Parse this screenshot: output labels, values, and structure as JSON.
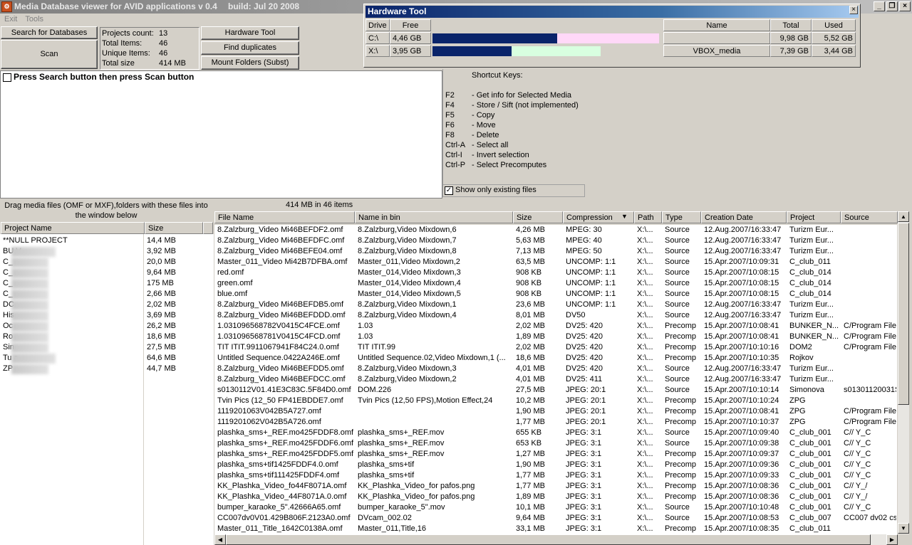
{
  "window": {
    "title": "Media Database viewer for AVID applications v 0.4",
    "build": "build: Jul 20 2008"
  },
  "menu": [
    "Exit",
    "Tools"
  ],
  "buttons": {
    "search": "Search for Databases",
    "scan": "Scan",
    "hardware": "Hardware Tool",
    "duplicates": "Find duplicates",
    "mount": "Mount Folders (Subst)"
  },
  "info": [
    {
      "label": "Projects count:",
      "value": "13"
    },
    {
      "label": "Total Items:",
      "value": "46"
    },
    {
      "label": "Unique Items:",
      "value": "46"
    },
    {
      "label": "Total size",
      "value": "414 MB"
    }
  ],
  "message": "Press Search button then press Scan button",
  "shortcuts": {
    "title": "Shortcut Keys:",
    "items": [
      {
        "key": "F2",
        "desc": "- Get info for Selected Media"
      },
      {
        "key": "F4",
        "desc": "- Store / Sift (not implemented)"
      },
      {
        "key": "F5",
        "desc": "- Copy"
      },
      {
        "key": "F6",
        "desc": "- Move"
      },
      {
        "key": "F8",
        "desc": "- Delete"
      },
      {
        "key": "Ctrl-A",
        "desc": "- Select all"
      },
      {
        "key": "Ctrl-I",
        "desc": "- Invert selection"
      },
      {
        "key": "Ctrl-P",
        "desc": "- Select Precomputes"
      }
    ],
    "existing_label": "Show only existing files"
  },
  "hwtool": {
    "title": "Hardware Tool",
    "drive_headers": [
      "Drive",
      "Free"
    ],
    "drives": [
      {
        "drive": "C:\\",
        "free": "4,46 GB",
        "used_fraction": 0.55,
        "bar_color": "#ffd8f8"
      },
      {
        "drive": "X:\\",
        "free": "3,95 GB",
        "used_fraction": 0.47,
        "bar_color": "#d8ffe0"
      }
    ],
    "vol_headers": [
      "Name",
      "Total",
      "Used"
    ],
    "volumes": [
      {
        "name": "",
        "total": "9,98 GB",
        "used": "5,52 GB"
      },
      {
        "name": "VBOX_media",
        "total": "7,39 GB",
        "used": "3,44 GB"
      }
    ],
    "bar_fill": "#0a246a"
  },
  "left": {
    "drag_note": "Drag media files (OMF or MXF),folders with these files into the window below",
    "headers": [
      "Project Name",
      "Size"
    ],
    "projects": [
      {
        "name": "**NULL PROJECT",
        "size": "14,4 MB"
      },
      {
        "name": "BU          V",
        "size": "3,92 MB"
      },
      {
        "name": "C_",
        "size": "20,0 MB"
      },
      {
        "name": "C_",
        "size": "9,64 MB"
      },
      {
        "name": "C_",
        "size": "175 MB"
      },
      {
        "name": "C_",
        "size": "2,66 MB"
      },
      {
        "name": "DC",
        "size": "2,02 MB"
      },
      {
        "name": "His",
        "size": "3,69 MB"
      },
      {
        "name": "Oc",
        "size": "26,2 MB"
      },
      {
        "name": "Ro",
        "size": "18,6 MB"
      },
      {
        "name": "Sin",
        "size": "27,5 MB"
      },
      {
        "name": "Tu          a",
        "size": "64,6 MB"
      },
      {
        "name": "ZP",
        "size": "44,7 MB"
      }
    ]
  },
  "main": {
    "summary": "414 MB in 46 items",
    "headers": [
      "File Name",
      "Name in bin",
      "Size",
      "Compression",
      "Path",
      "Type",
      "Creation Date",
      "Project",
      "Source"
    ],
    "rows": [
      [
        "8.Zalzburg_Video Mi46BEFDF2.omf",
        "8.Zalzburg,Video Mixdown,6",
        "4,26 MB",
        "MPEG: 30",
        "X:\\...",
        "Source",
        "12.Aug.2007/16:33:47",
        "Turizm Eur...",
        ""
      ],
      [
        "8.Zalzburg_Video Mi46BEFDFC.omf",
        "8.Zalzburg,Video Mixdown,7",
        "5,63 MB",
        "MPEG: 40",
        "X:\\...",
        "Source",
        "12.Aug.2007/16:33:47",
        "Turizm Eur...",
        ""
      ],
      [
        "8.Zalzburg_Video Mi46BEFE04.omf",
        "8.Zalzburg,Video Mixdown,8",
        "7,13 MB",
        "MPEG: 50",
        "X:\\...",
        "Source",
        "12.Aug.2007/16:33:47",
        "Turizm Eur...",
        ""
      ],
      [
        "Master_011_Video Mi42B7DFBA.omf",
        "Master_011,Video Mixdown,2",
        "63,5 MB",
        "UNCOMP: 1:1",
        "X:\\...",
        "Source",
        "15.Apr.2007/10:09:31",
        "C_club_011",
        ""
      ],
      [
        "red.omf",
        "Master_014,Video Mixdown,3",
        "908 KB",
        "UNCOMP: 1:1",
        "X:\\...",
        "Source",
        "15.Apr.2007/10:08:15",
        "C_club_014",
        ""
      ],
      [
        "green.omf",
        "Master_014,Video Mixdown,4",
        "908 KB",
        "UNCOMP: 1:1",
        "X:\\...",
        "Source",
        "15.Apr.2007/10:08:15",
        "C_club_014",
        ""
      ],
      [
        "blue.omf",
        "Master_014,Video Mixdown,5",
        "908 KB",
        "UNCOMP: 1:1",
        "X:\\...",
        "Source",
        "15.Apr.2007/10:08:15",
        "C_club_014",
        ""
      ],
      [
        "8.Zalzburg_Video Mi46BEFDB5.omf",
        "8.Zalzburg,Video Mixdown,1",
        "23,6 MB",
        "UNCOMP: 1:1",
        "X:\\...",
        "Source",
        "12.Aug.2007/16:33:47",
        "Turizm Eur...",
        ""
      ],
      [
        "8.Zalzburg_Video Mi46BEFDDD.omf",
        "8.Zalzburg,Video Mixdown,4",
        "8,01 MB",
        "DV50",
        "X:\\...",
        "Source",
        "12.Aug.2007/16:33:47",
        "Turizm Eur...",
        ""
      ],
      [
        "1.031096568782V0415C4FCE.omf",
        "1.03",
        "2,02 MB",
        "DV25: 420",
        "X:\\...",
        "Precomp",
        "15.Apr.2007/10:08:41",
        "BUNKER_N...",
        "C/Program Files"
      ],
      [
        "1.031096568781V0415C4FCD.omf",
        "1.03",
        "1,89 MB",
        "DV25: 420",
        "X:\\...",
        "Precomp",
        "15.Apr.2007/10:08:41",
        "BUNKER_N...",
        "C/Program Files"
      ],
      [
        "TIT ITIT.9911067941F84C24.0.omf",
        "TIT ITIT.99",
        "2,02 MB",
        "DV25: 420",
        "X:\\...",
        "Precomp",
        "15.Apr.2007/10:10:16",
        "DOM2",
        "C/Program Files"
      ],
      [
        "Untitled Sequence.0422A246E.omf",
        "Untitled Sequence.02,Video Mixdown,1 (...",
        "18,6 MB",
        "DV25: 420",
        "X:\\...",
        "Precomp",
        "15.Apr.2007/10:10:35",
        "Rojkov",
        ""
      ],
      [
        "8.Zalzburg_Video Mi46BEFDD5.omf",
        "8.Zalzburg,Video Mixdown,3",
        "4,01 MB",
        "DV25: 420",
        "X:\\...",
        "Source",
        "12.Aug.2007/16:33:47",
        "Turizm Eur...",
        ""
      ],
      [
        "8.Zalzburg_Video Mi46BEFDCC.omf",
        "8.Zalzburg,Video Mixdown,2",
        "4,01 MB",
        "DV25: 411",
        "X:\\...",
        "Source",
        "12.Aug.2007/16:33:47",
        "Turizm Eur...",
        ""
      ],
      [
        "s0130112V01.41E3C83C.5F84D0.omf",
        "DOM.226",
        "27,5 MB",
        "JPEG: 20:1",
        "X:\\...",
        "Source",
        "15.Apr.2007/10:10:14",
        "Simonova",
        "s01301120031S"
      ],
      [
        "Tvin Pics (12_50 FP41EBDDE7.omf",
        "Tvin Pics (12,50 FPS),Motion Effect,24",
        "10,2 MB",
        "JPEG: 20:1",
        "X:\\...",
        "Precomp",
        "15.Apr.2007/10:10:24",
        "ZPG",
        ""
      ],
      [
        "1119201063V042B5A727.omf",
        "",
        "1,90 MB",
        "JPEG: 20:1",
        "X:\\...",
        "Precomp",
        "15.Apr.2007/10:08:41",
        "ZPG",
        "C/Program Files"
      ],
      [
        "1119201062V042B5A726.omf",
        "",
        "1,77 MB",
        "JPEG: 20:1",
        "X:\\...",
        "Precomp",
        "15.Apr.2007/10:10:37",
        "ZPG",
        "C/Program Files"
      ],
      [
        "plashka_sms+_REF.mo425FDDF8.omf",
        "plashka_sms+_REF.mov",
        "655 KB",
        "JPEG: 3:1",
        "X:\\...",
        "Source",
        "15.Apr.2007/10:09:40",
        "C_club_001",
        "C//          Y_C"
      ],
      [
        "plashka_sms+_REF.mo425FDDF6.omf",
        "plashka_sms+_REF.mov",
        "653 KB",
        "JPEG: 3:1",
        "X:\\...",
        "Source",
        "15.Apr.2007/10:09:38",
        "C_club_001",
        "C//          Y_C"
      ],
      [
        "plashka_sms+_REF.mo425FDDF5.omf",
        "plashka_sms+_REF.mov",
        "1,27 MB",
        "JPEG: 3:1",
        "X:\\...",
        "Precomp",
        "15.Apr.2007/10:09:37",
        "C_club_001",
        "C//          Y_C"
      ],
      [
        "plashka_sms+tif1425FDDF4.0.omf",
        "plashka_sms+tif",
        "1,90 MB",
        "JPEG: 3:1",
        "X:\\...",
        "Precomp",
        "15.Apr.2007/10:09:36",
        "C_club_001",
        "C//          Y_C"
      ],
      [
        "plashka_sms+tif111425FDDF4.omf",
        "plashka_sms+tif",
        "1,77 MB",
        "JPEG: 3:1",
        "X:\\...",
        "Precomp",
        "15.Apr.2007/10:09:33",
        "C_club_001",
        "C//          Y_C"
      ],
      [
        "KK_Plashka_Video_fo44F8071A.omf",
        "KK_Plashka_Video_for pafos.png",
        "1,77 MB",
        "JPEG: 3:1",
        "X:\\...",
        "Precomp",
        "15.Apr.2007/10:08:36",
        "C_club_001",
        "C//          Y_/"
      ],
      [
        "KK_Plashka_Video_44F8071A.0.omf",
        "KK_Plashka_Video_for pafos.png",
        "1,89 MB",
        "JPEG: 3:1",
        "X:\\...",
        "Precomp",
        "15.Apr.2007/10:08:36",
        "C_club_001",
        "C//          Y_/"
      ],
      [
        "bumper_karaoke_5\".42666A65.omf",
        "bumper_karaoke_5\".mov",
        "10,1 MB",
        "JPEG: 3:1",
        "X:\\...",
        "Source",
        "15.Apr.2007/10:10:48",
        "C_club_001",
        "C//          Y_C"
      ],
      [
        "CC007dv0V01.429B806F.2123A0.omf",
        "DVcam_002.02",
        "9,64 MB",
        "JPEG: 3:1",
        "X:\\...",
        "Source",
        "15.Apr.2007/10:08:53",
        "C_club_007",
        "CC007 dv02 cs"
      ],
      [
        "Master_011_Title_1642C0138A.omf",
        "Master_011,Title,16",
        "33,1 MB",
        "JPEG: 3:1",
        "X:\\...",
        "Precomp",
        "15.Apr.2007/10:08:35",
        "C_club_011",
        ""
      ]
    ]
  }
}
